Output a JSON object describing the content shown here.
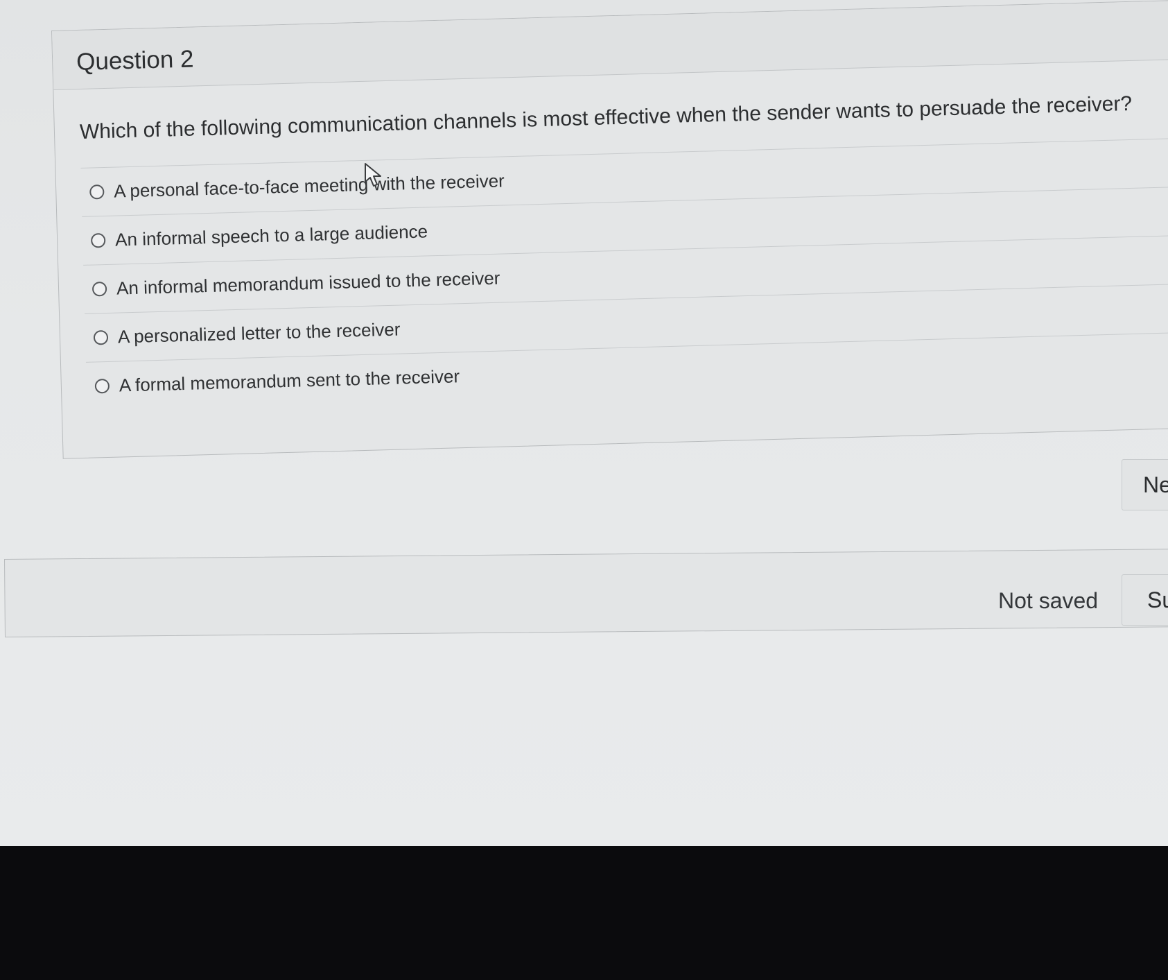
{
  "question": {
    "title": "Question 2",
    "text": "Which of the following communication channels is most effective when the sender wants to persuade the receiver?",
    "answers": [
      "A personal face-to-face meeting with the receiver",
      "An informal speech to a large audience",
      "An informal memorandum issued to the receiver",
      "A personalized letter to the receiver",
      "A formal memorandum sent to the receiver"
    ]
  },
  "navigation": {
    "next_label": "Ne"
  },
  "footer": {
    "save_status": "Not saved",
    "submit_label": "Su"
  }
}
